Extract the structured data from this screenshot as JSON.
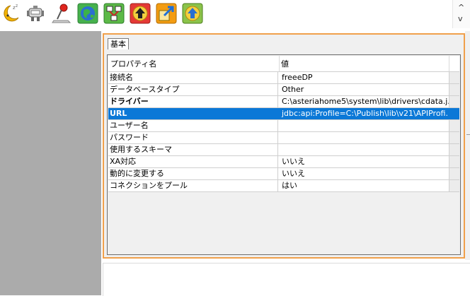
{
  "toolbar": {
    "buttons": [
      {
        "name": "sleep-moon-icon",
        "color": "#f0b400"
      },
      {
        "name": "robot-icon",
        "color": "#555555"
      },
      {
        "name": "pin-icon",
        "color": "#d8231d"
      },
      {
        "name": "globe-icon",
        "color": "#2aa84a"
      },
      {
        "name": "network-icon",
        "color": "#4caf50"
      },
      {
        "name": "upload-red-icon",
        "color": "#e53935"
      },
      {
        "name": "export-orange-icon",
        "color": "#f39c12"
      },
      {
        "name": "upload-green-icon",
        "color": "#7dc242"
      }
    ],
    "scroll_up": "^",
    "scroll_down": "v"
  },
  "editor": {
    "tab_label": "基本",
    "header": {
      "property": "プロパティ名",
      "value": "値"
    },
    "rows": [
      {
        "key": "接続名",
        "value": "freeeDP"
      },
      {
        "key": "データベースタイプ",
        "value": "Other"
      },
      {
        "key": "ドライバー",
        "value": "C:\\asteriahome5\\system\\lib\\drivers\\cdata.j..."
      },
      {
        "key": "URL",
        "value": "jdbc:api:Profile=C:\\Publish\\lib\\v21\\APIProfi..."
      },
      {
        "key": "ユーザー名",
        "value": ""
      },
      {
        "key": "パスワード",
        "value": ""
      },
      {
        "key": "使用するスキーマ",
        "value": ""
      },
      {
        "key": "XA対応",
        "value": "いいえ"
      },
      {
        "key": "動的に変更する",
        "value": "いいえ"
      },
      {
        "key": "コネクションをプール",
        "value": "はい"
      }
    ]
  },
  "colors": {
    "selection": "#0b78d7",
    "frame": "#f0a04b",
    "left_pane": "#ababab"
  }
}
